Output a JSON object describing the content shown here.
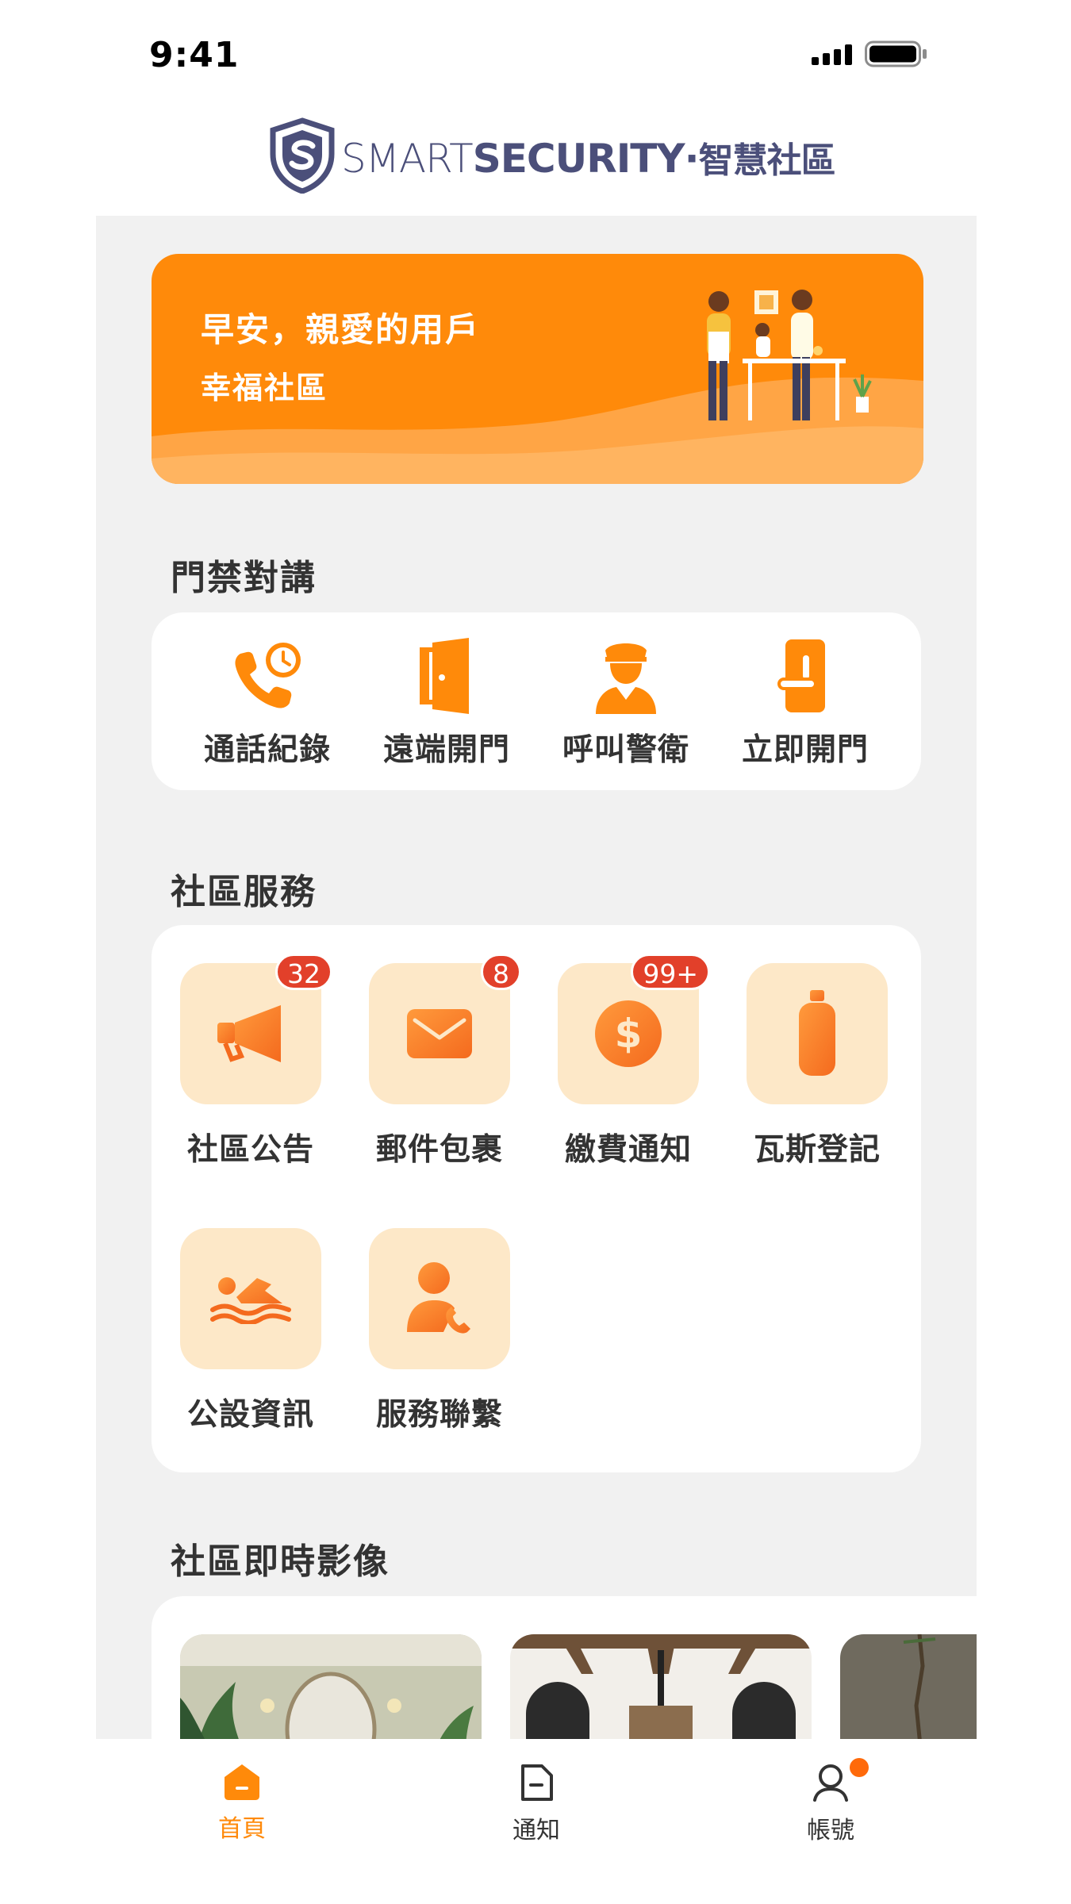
{
  "status_bar": {
    "time": "9:41"
  },
  "header": {
    "logo_smart": "SMART",
    "logo_security": "SECURITY",
    "logo_dot": "·",
    "logo_cn": "智慧社區"
  },
  "banner": {
    "greeting": "早安，親愛的用戶",
    "community": "幸福社區"
  },
  "sections": {
    "access": "門禁對講",
    "services": "社區服務",
    "cameras": "社區即時影像"
  },
  "access_items": [
    {
      "label": "通話紀錄",
      "icon": "phone-clock-icon"
    },
    {
      "label": "遠端開門",
      "icon": "door-open-icon"
    },
    {
      "label": "呼叫警衛",
      "icon": "guard-icon"
    },
    {
      "label": "立即開門",
      "icon": "door-handle-icon"
    }
  ],
  "service_items": [
    {
      "label": "社區公告",
      "icon": "megaphone-icon",
      "badge": "32"
    },
    {
      "label": "郵件包裹",
      "icon": "mail-icon",
      "badge": "8"
    },
    {
      "label": "繳費通知",
      "icon": "dollar-coin-icon",
      "badge": "99+"
    },
    {
      "label": "瓦斯登記",
      "icon": "gas-tank-icon"
    },
    {
      "label": "公設資訊",
      "icon": "swimmer-icon"
    },
    {
      "label": "服務聯繫",
      "icon": "contact-phone-icon"
    }
  ],
  "tabbar": {
    "home": "首頁",
    "notice": "通知",
    "account": "帳號"
  },
  "colors": {
    "accent": "#ff8a0a",
    "tile_bg": "#fde8c8",
    "badge": "#e2402a",
    "logo": "#4b4f7a"
  }
}
